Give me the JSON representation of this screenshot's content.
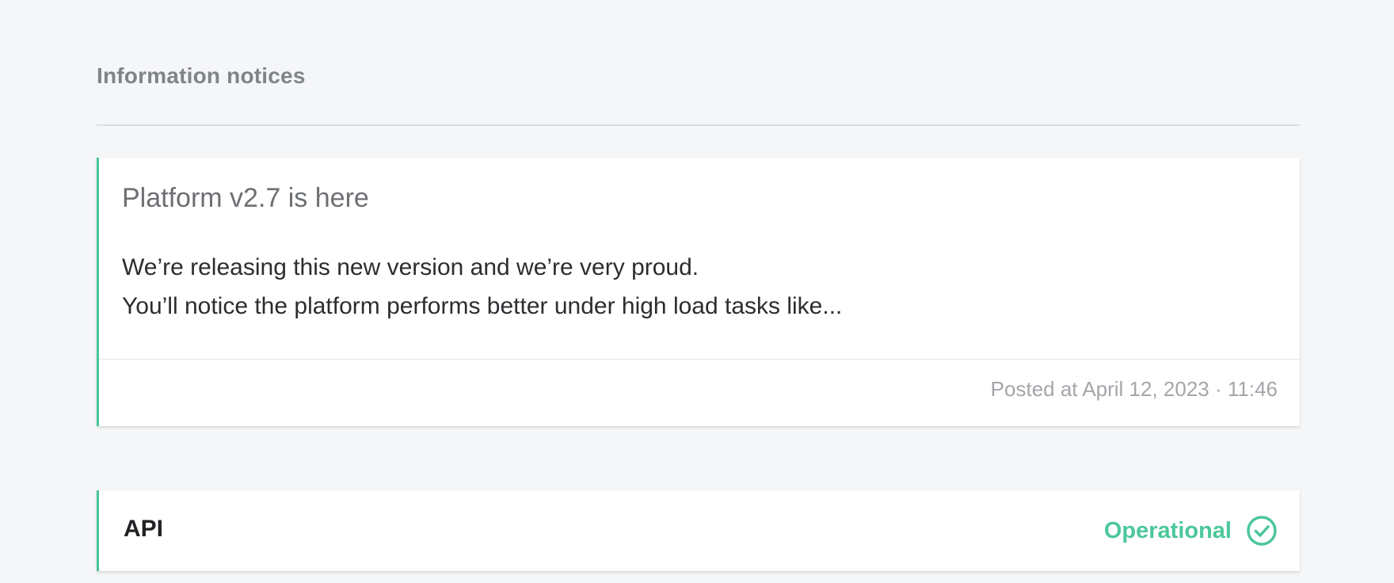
{
  "section": {
    "title": "Information notices"
  },
  "notice": {
    "title": "Platform v2.7 is here",
    "body_lines": [
      "We’re releasing this new version and we’re very proud.",
      "You’ll notice the platform performs better under high load tasks like..."
    ],
    "posted": "Posted at April 12, 2023 · 11:46"
  },
  "component": {
    "name": "API",
    "status": "Operational",
    "status_icon": "check-circle-icon"
  },
  "colors": {
    "accent": "#4cc79a",
    "background": "#f5f6f8",
    "card": "#ffffff"
  }
}
